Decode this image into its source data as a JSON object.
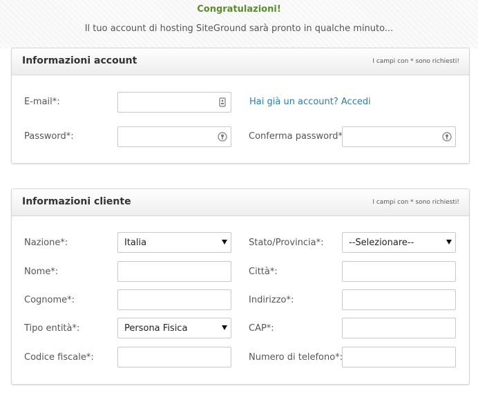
{
  "banner": {
    "title": "Congratulazioni!",
    "subtitle": "Il tuo account di hosting SiteGround sarà pronto in qualche minuto..."
  },
  "account_panel": {
    "title": "Informazioni account",
    "required_note": "I campi con * sono richiesti!",
    "email_label": "E-mail*:",
    "email_value": "",
    "login_link": "Hai già un account? Accedi",
    "password_label": "Password*:",
    "password_value": "",
    "confirm_password_label": "Conferma password*:",
    "confirm_password_value": ""
  },
  "customer_panel": {
    "title": "Informazioni cliente",
    "required_note": "I campi con * sono richiesti!",
    "nazione_label": "Nazione*:",
    "nazione_value": "Italia",
    "stato_label": "Stato/Provincia*:",
    "stato_value": "--Selezionare--",
    "nome_label": "Nome*:",
    "citta_label": "Città*:",
    "cognome_label": "Cognome*:",
    "indirizzo_label": "Indirizzo*:",
    "tipo_entita_label": "Tipo entità*:",
    "tipo_entita_value": "Persona Fisica",
    "cap_label": "CAP*:",
    "codice_fiscale_label": "Codice fiscale*:",
    "telefono_label": "Numero di telefono*:"
  },
  "colors": {
    "accent_green": "#5c8a2e",
    "link_blue": "#2a7bb5"
  }
}
